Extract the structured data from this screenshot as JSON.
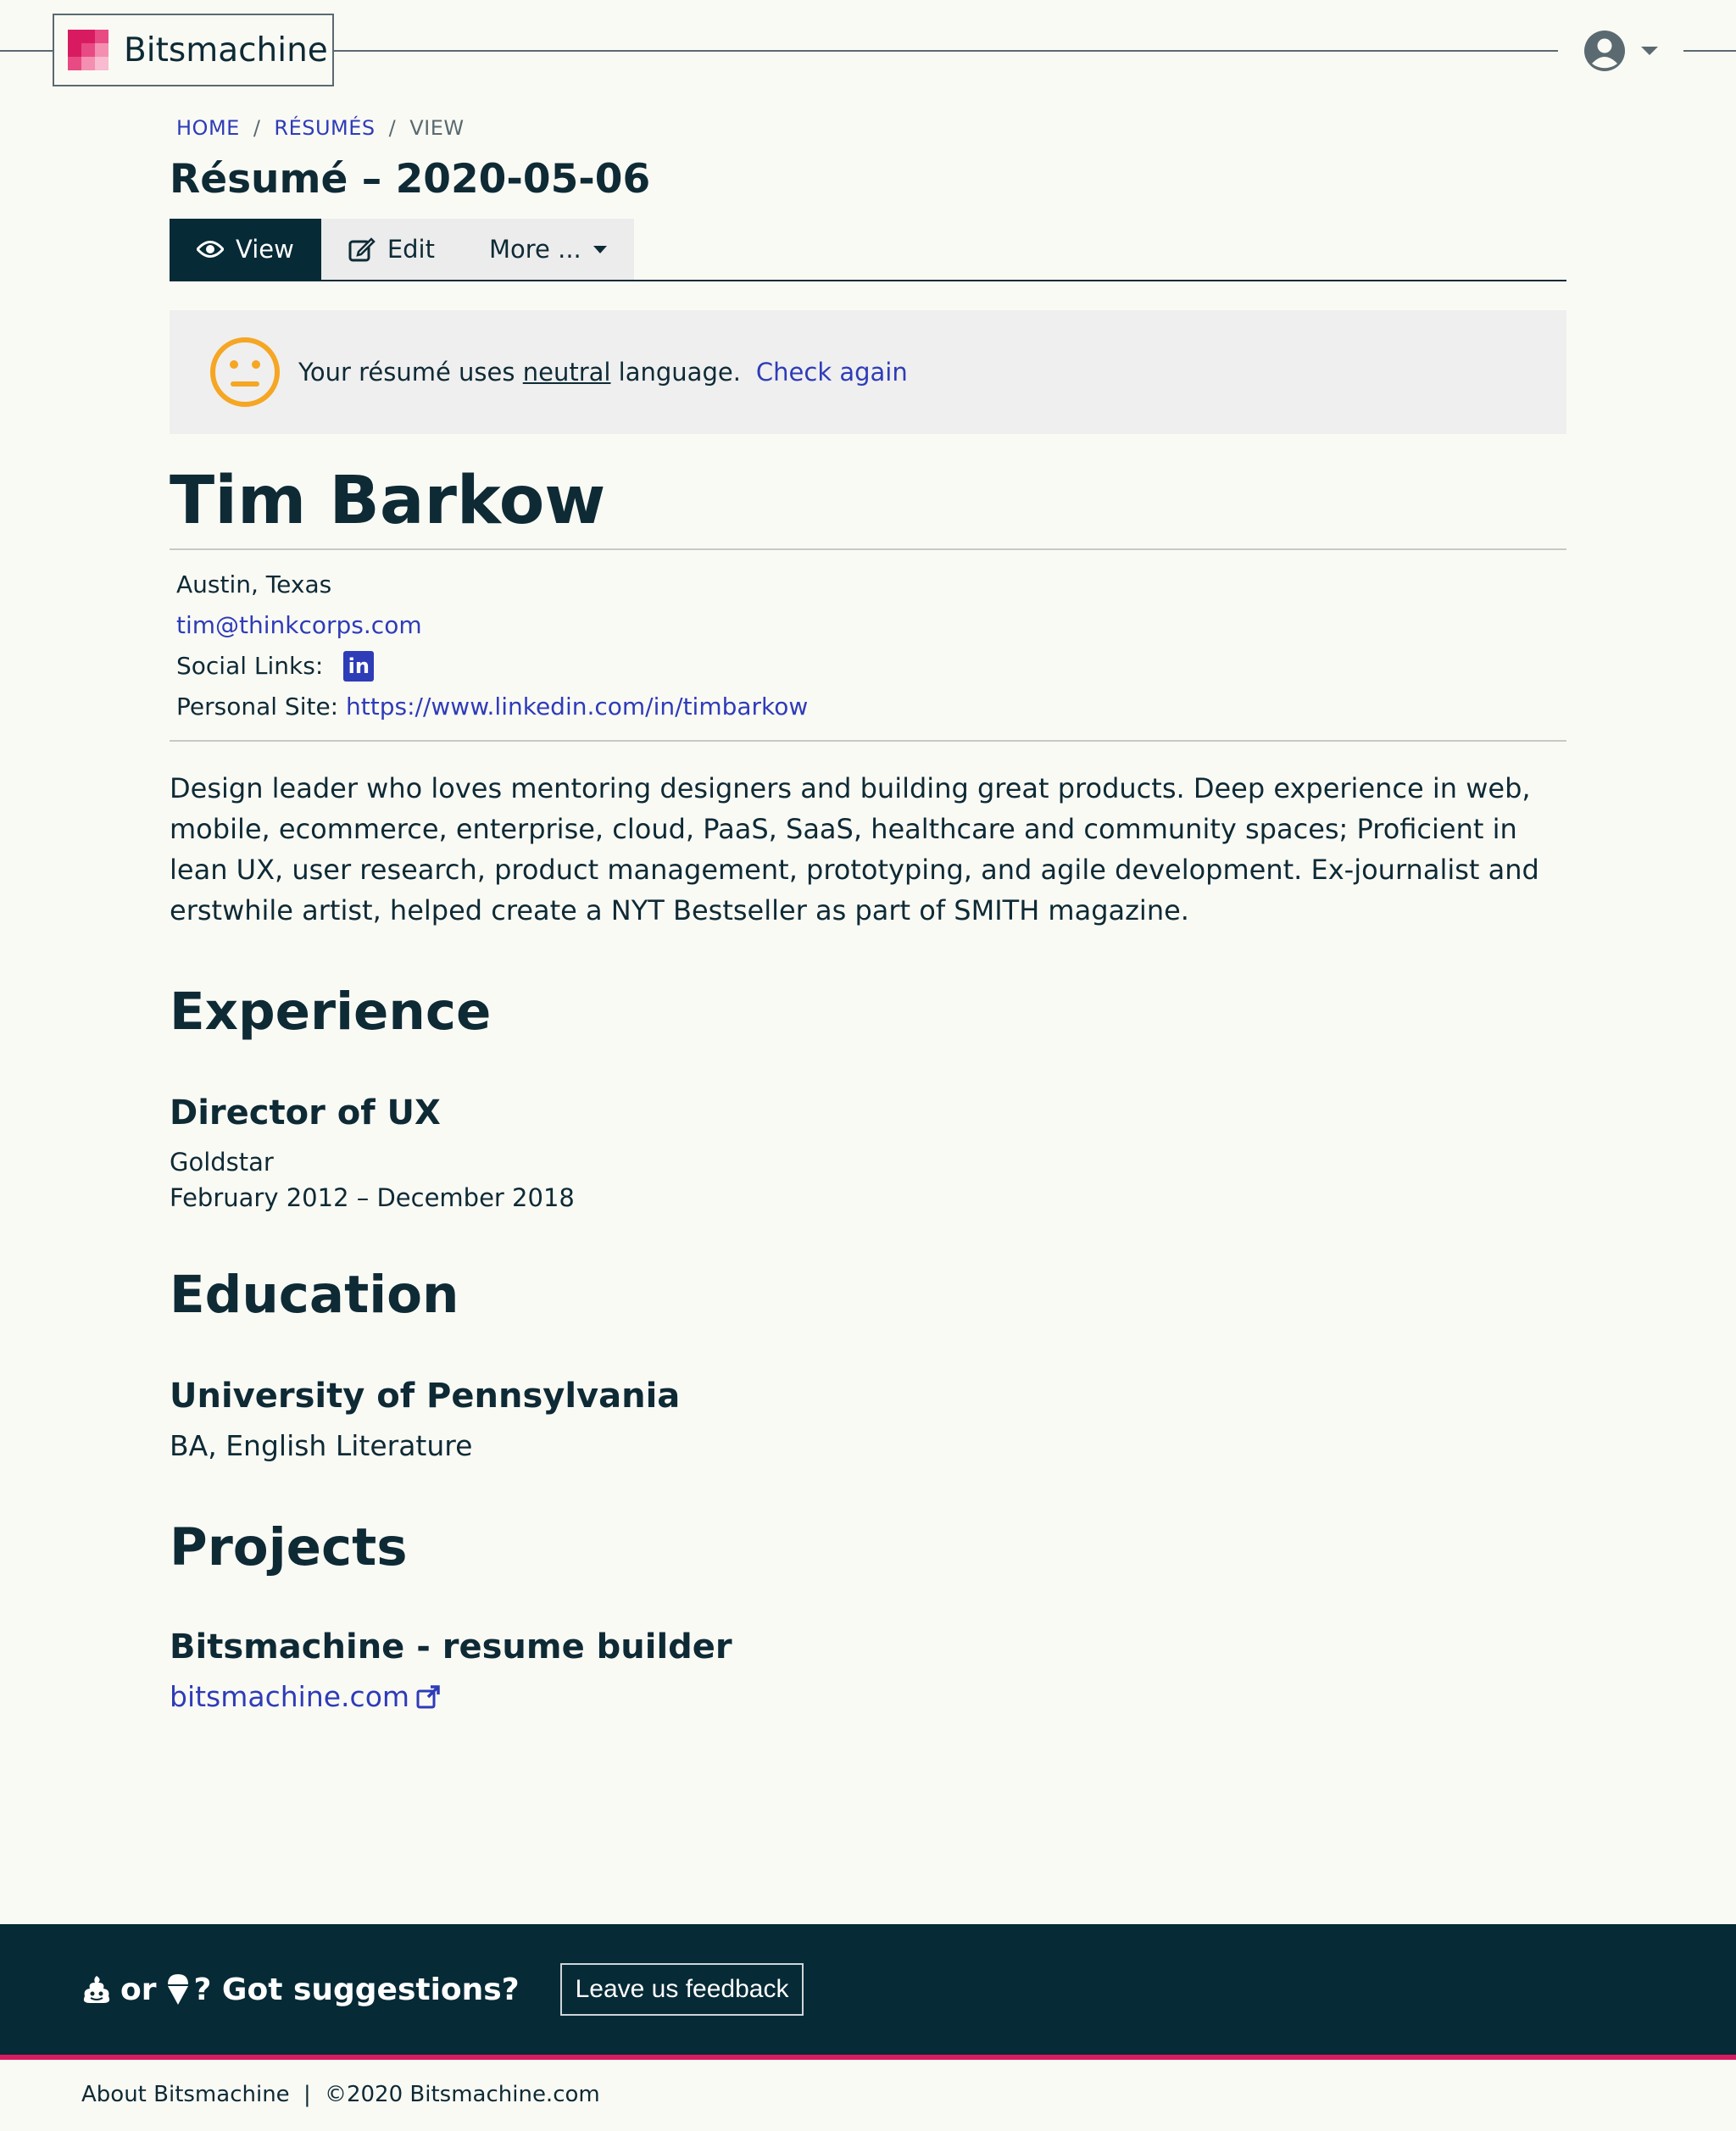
{
  "app": {
    "brand": "Bitsmachine",
    "brand_colors": [
      "#d81b60",
      "#e84a84",
      "#f48fb1",
      "#f8bbd0"
    ]
  },
  "header": {
    "user_icon": "user-circle-icon"
  },
  "breadcrumb": {
    "items": [
      "HOME",
      "RÉSUMÉS",
      "VIEW"
    ],
    "sep": "/"
  },
  "page": {
    "title": "Résumé – 2020-05-06"
  },
  "tabs": {
    "view": "View",
    "edit": "Edit",
    "more": "More ..."
  },
  "alert": {
    "prefix": "Your résumé uses",
    "keyword": "neutral",
    "suffix": "language.",
    "action": "Check again",
    "icon": "neutral-face-icon",
    "icon_color": "#f5a623"
  },
  "resume": {
    "name": "Tim Barkow",
    "location": "Austin, Texas",
    "email": "tim@thinkcorps.com",
    "social_label": "Social Links:",
    "social_icon": "linkedin-icon",
    "site_label": "Personal Site:",
    "site_url": "https://www.linkedin.com/in/timbarkow",
    "summary": "Design leader who loves mentoring designers and building great products. Deep experience in web, mobile, ecommerce, enterprise, cloud, PaaS, SaaS, healthcare and community spaces; Proficient in lean UX, user research, product management, prototyping, and agile development. Ex-journalist and erstwhile artist, helped create a NYT Bestseller as part of SMITH magazine."
  },
  "experience": {
    "heading": "Experience",
    "jobs": [
      {
        "title": "Director of UX",
        "company": "Goldstar",
        "dates": "February 2012 – December 2018"
      }
    ]
  },
  "education": {
    "heading": "Education",
    "schools": [
      {
        "name": "University of Pennsylvania",
        "degree": "BA, English Literature"
      }
    ]
  },
  "projects": {
    "heading": "Projects",
    "items": [
      {
        "name": "Bitsmachine - resume builder",
        "link": "bitsmachine.com"
      }
    ]
  },
  "footer": {
    "or": "or",
    "question": "? Got suggestions?",
    "feedback_button": "Leave us feedback",
    "about": "About Bitsmachine",
    "divider": "|",
    "copyright": "©2020 Bitsmachine.com"
  }
}
